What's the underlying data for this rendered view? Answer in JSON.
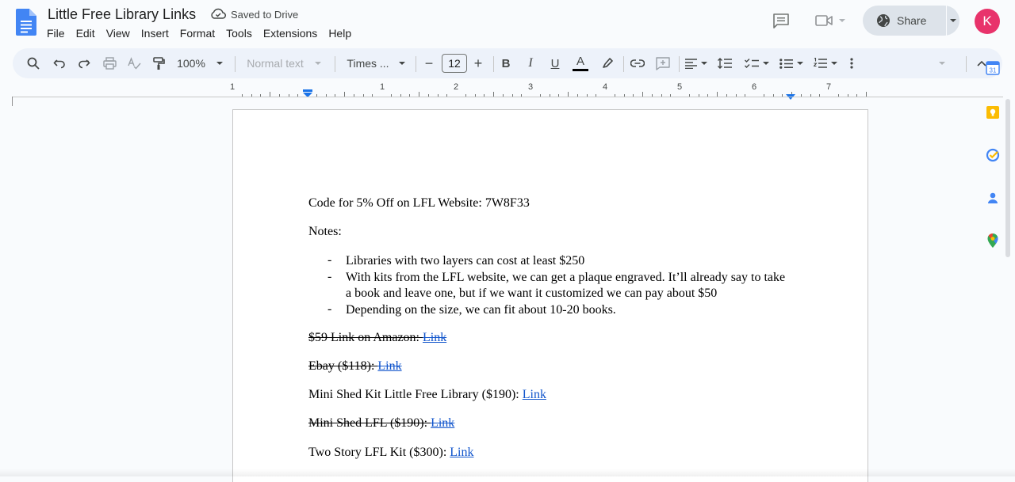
{
  "header": {
    "title": "Little Free Library Links",
    "save_status": "Saved to Drive",
    "share_label": "Share",
    "avatar_initial": "K",
    "avatar_color": "#e8336b"
  },
  "menu": [
    "File",
    "Edit",
    "View",
    "Insert",
    "Format",
    "Tools",
    "Extensions",
    "Help"
  ],
  "toolbar": {
    "zoom": "100%",
    "style": "Normal text",
    "font": "Times ...",
    "font_size": "12",
    "bold": "B",
    "italic": "I",
    "underline": "U",
    "text_color": "A",
    "minus": "−",
    "plus": "+"
  },
  "ruler": {
    "labels": [
      "1",
      "1",
      "2",
      "3",
      "4",
      "5",
      "6",
      "7"
    ]
  },
  "document": {
    "code_line": "Code for 5% Off on LFL Website: 7W8F33",
    "notes_label": "Notes:",
    "bullet_marker": "-",
    "bullets": [
      "Libraries with two layers can cost at least $250",
      "With kits from the LFL website, we can get a plaque engraved. It’ll already say to take a book and leave one, but if we want it customized we can pay about $50",
      "Depending on the size, we can fit about 10-20 books."
    ],
    "links": [
      {
        "text": "$59 Link on Amazon: ",
        "link": "Link",
        "struck": true
      },
      {
        "text": "Ebay ($118): ",
        "link": "Link",
        "struck": true
      },
      {
        "text": "Mini Shed Kit Little Free Library ($190): ",
        "link": "Link",
        "struck": false
      },
      {
        "text": "Mini Shed LFL ($190): ",
        "link": "Link",
        "struck": true
      },
      {
        "text": "Two Story LFL Kit ($300): ",
        "link": "Link",
        "struck": false
      }
    ]
  }
}
